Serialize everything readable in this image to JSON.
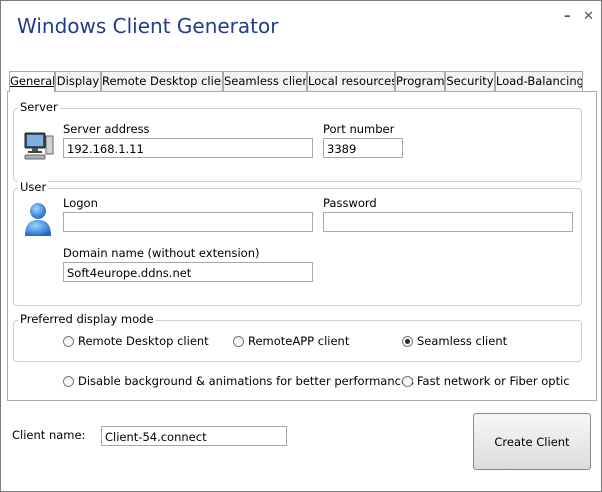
{
  "window": {
    "title": "Windows Client Generator",
    "minimize": "–",
    "close": "✕"
  },
  "tabs": [
    {
      "label": "General",
      "active": true
    },
    {
      "label": "Display"
    },
    {
      "label": "Remote Desktop client"
    },
    {
      "label": "Seamless client"
    },
    {
      "label": "Local resources"
    },
    {
      "label": "Program"
    },
    {
      "label": "Security"
    },
    {
      "label": "Load-Balancing"
    }
  ],
  "server": {
    "group_label": "Server",
    "icon": "computer-icon",
    "address_label": "Server address",
    "address_value": "192.168.1.11",
    "port_label": "Port number",
    "port_value": "3389"
  },
  "user": {
    "group_label": "User",
    "icon": "user-icon",
    "logon_label": "Logon",
    "logon_value": "",
    "password_label": "Password",
    "password_value": "",
    "domain_label": "Domain name (without extension)",
    "domain_value": "Soft4europe.ddns.net"
  },
  "display_mode": {
    "group_label": "Preferred display mode",
    "options": [
      {
        "label": "Remote Desktop client",
        "checked": false
      },
      {
        "label": "RemoteAPP client",
        "checked": false
      },
      {
        "label": "Seamless client",
        "checked": true
      }
    ]
  },
  "performance": {
    "disable_bg_label": "Disable background & animations for better performances",
    "fast_network_label": "Fast network or Fiber optic"
  },
  "footer": {
    "client_name_label": "Client name:",
    "client_name_value": "Client-54.connect",
    "create_button": "Create Client"
  }
}
